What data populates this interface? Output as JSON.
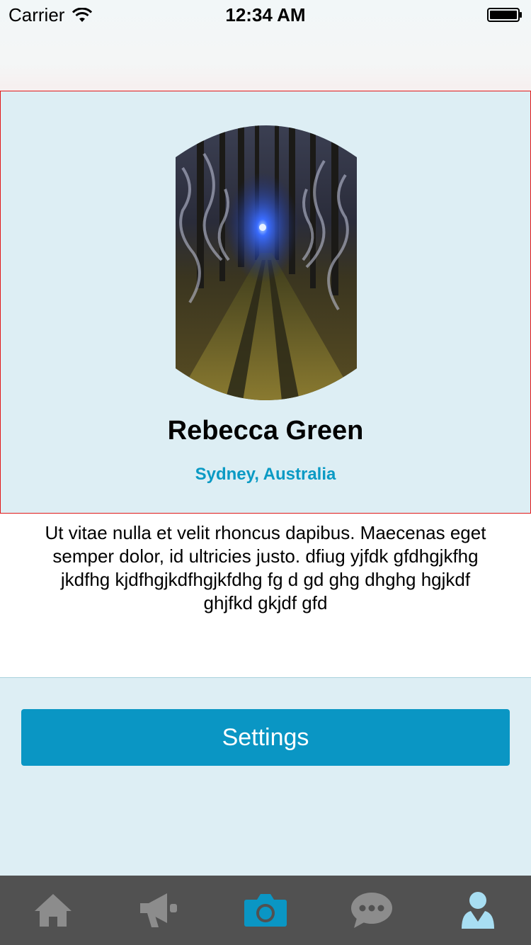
{
  "status_bar": {
    "carrier": "Carrier",
    "time": "12:34 AM"
  },
  "profile": {
    "name": "Rebecca Green",
    "location": "Sydney, Australia",
    "bio": "Ut vitae nulla et velit rhoncus dapibus. Maecenas eget semper dolor, id ultricies justo. dfiug yjfdk gfdhgjkfhg jkdfhg kjdfhgjkdfhgjkfdhg fg d gd ghg dhghg hgjkdf ghjfkd gkjdf gfd"
  },
  "settings": {
    "button_label": "Settings"
  },
  "tab_bar": {
    "items": [
      {
        "icon": "home-icon",
        "active": false
      },
      {
        "icon": "megaphone-icon",
        "active": false
      },
      {
        "icon": "camera-icon",
        "active": true
      },
      {
        "icon": "chat-icon",
        "active": false
      },
      {
        "icon": "person-icon",
        "active": true
      }
    ]
  },
  "colors": {
    "accent": "#0a96c4",
    "card_background": "#ddeef4",
    "tab_bar": "#515151",
    "tab_icon_inactive": "#8c8c8c",
    "tab_icon_camera": "#0a96c4",
    "tab_icon_profile": "#a8def2"
  }
}
